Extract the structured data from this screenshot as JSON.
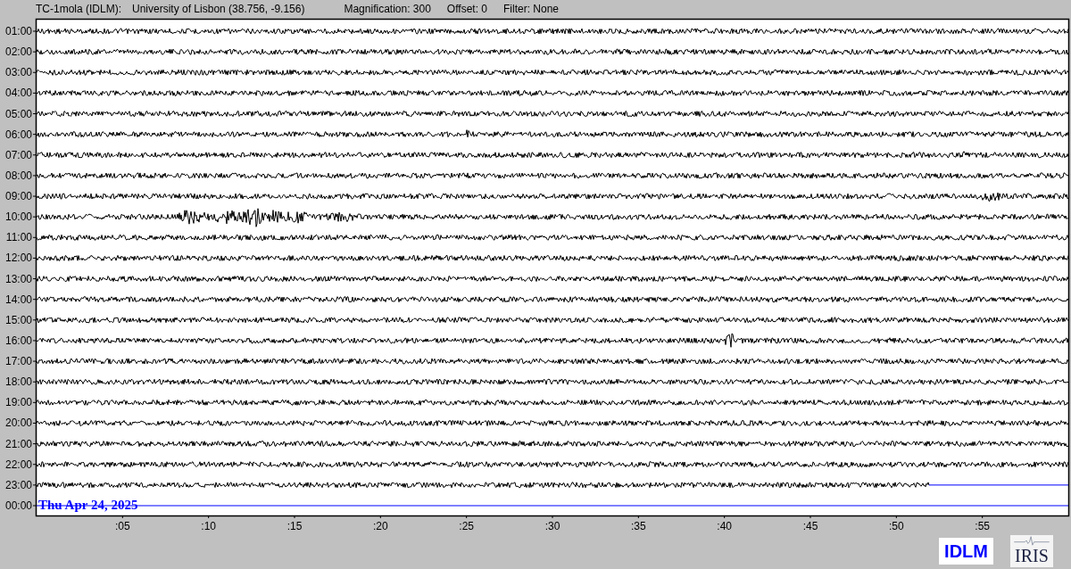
{
  "header": {
    "station": "TC-1mola (IDLM):",
    "location": "University of Lisbon (38.756, -9.156)",
    "magnification": "Magnification: 300",
    "offset": "Offset: 0",
    "filter": "Filter: None"
  },
  "rows": [
    {
      "label": "01:00",
      "kind": "trace"
    },
    {
      "label": "02:00",
      "kind": "trace"
    },
    {
      "label": "03:00",
      "kind": "trace"
    },
    {
      "label": "04:00",
      "kind": "trace"
    },
    {
      "label": "05:00",
      "kind": "trace"
    },
    {
      "label": "06:00",
      "kind": "trace"
    },
    {
      "label": "07:00",
      "kind": "trace"
    },
    {
      "label": "08:00",
      "kind": "trace"
    },
    {
      "label": "09:00",
      "kind": "trace"
    },
    {
      "label": "10:00",
      "kind": "trace"
    },
    {
      "label": "11:00",
      "kind": "trace"
    },
    {
      "label": "12:00",
      "kind": "trace"
    },
    {
      "label": "13:00",
      "kind": "trace"
    },
    {
      "label": "14:00",
      "kind": "trace"
    },
    {
      "label": "15:00",
      "kind": "trace"
    },
    {
      "label": "16:00",
      "kind": "trace"
    },
    {
      "label": "17:00",
      "kind": "trace"
    },
    {
      "label": "18:00",
      "kind": "trace"
    },
    {
      "label": "19:00",
      "kind": "trace"
    },
    {
      "label": "20:00",
      "kind": "trace"
    },
    {
      "label": "21:00",
      "kind": "trace"
    },
    {
      "label": "22:00",
      "kind": "trace"
    },
    {
      "label": "23:00",
      "kind": "partial"
    },
    {
      "label": "00:00",
      "kind": "pending"
    }
  ],
  "date_label": "Thu Apr 24, 2025",
  "x_ticks": [
    ":05",
    ":10",
    ":15",
    ":20",
    ":25",
    ":30",
    ":35",
    ":40",
    ":45",
    ":50",
    ":55"
  ],
  "logos": {
    "station": "IDLM",
    "network": "IRIS"
  }
}
